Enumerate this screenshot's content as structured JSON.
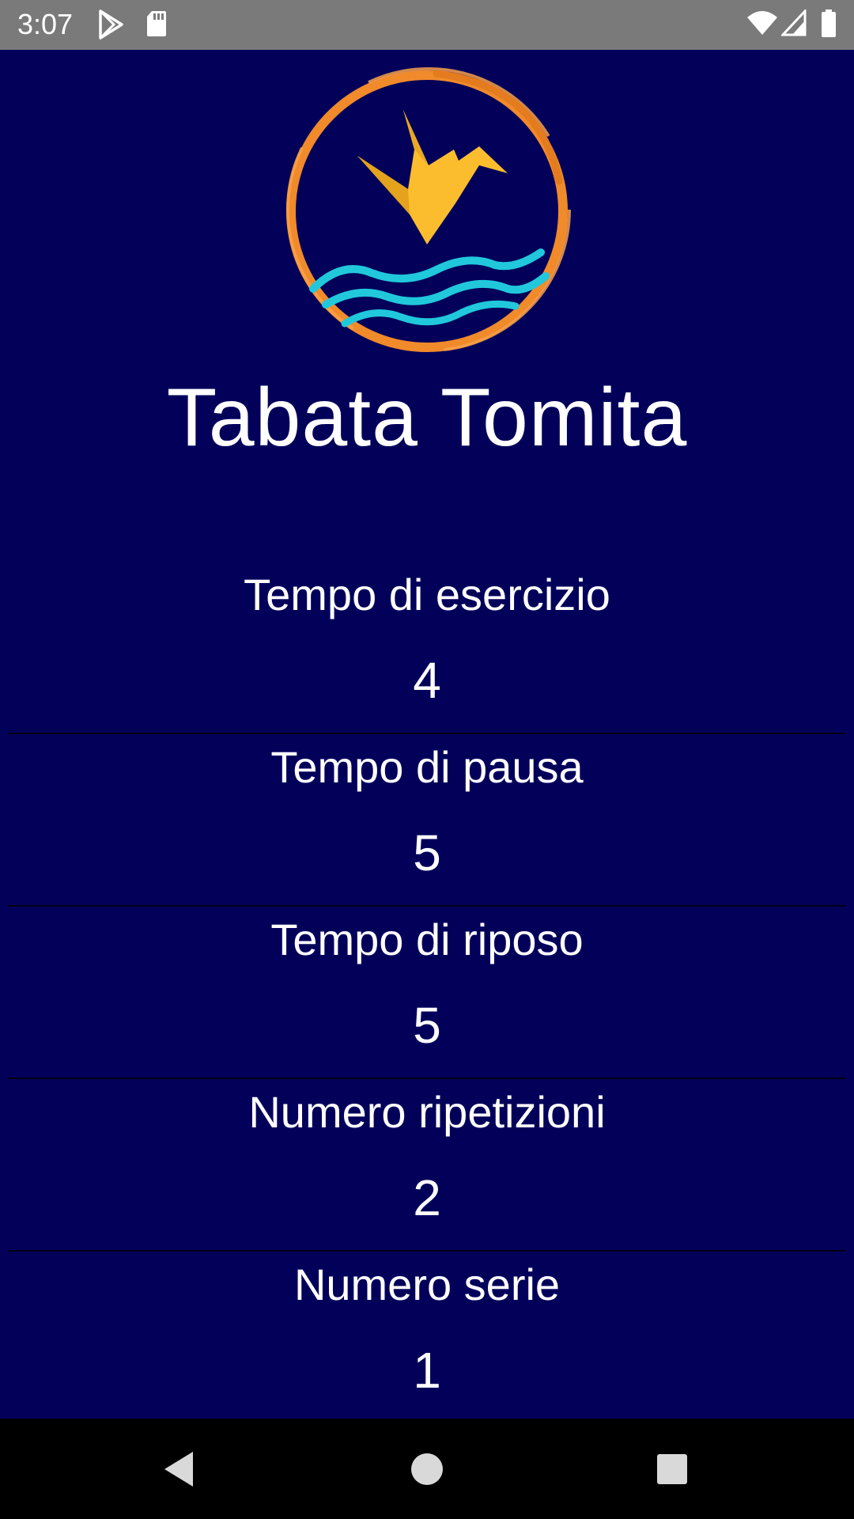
{
  "status_bar": {
    "time": "3:07",
    "icons": [
      "play-store-icon",
      "sd-card-icon",
      "wifi-icon",
      "signal-icon",
      "battery-icon"
    ]
  },
  "app": {
    "title": "Tabata Tomita",
    "logo": "origami-crane-logo"
  },
  "settings": [
    {
      "label": "Tempo di esercizio",
      "value": "4"
    },
    {
      "label": "Tempo di pausa",
      "value": "5"
    },
    {
      "label": "Tempo di riposo",
      "value": "5"
    },
    {
      "label": "Numero ripetizioni",
      "value": "2"
    },
    {
      "label": "Numero serie",
      "value": "1"
    }
  ],
  "nav_bar": {
    "buttons": [
      "back-icon",
      "home-icon",
      "recents-icon"
    ]
  },
  "colors": {
    "background": "#03005a",
    "status_bar": "#7a7a7a",
    "nav_bar": "#000000",
    "logo_ring": "#f08a2a",
    "logo_crane": "#fbbd2d",
    "logo_waves": "#21c8dc",
    "text": "#ffffff"
  }
}
